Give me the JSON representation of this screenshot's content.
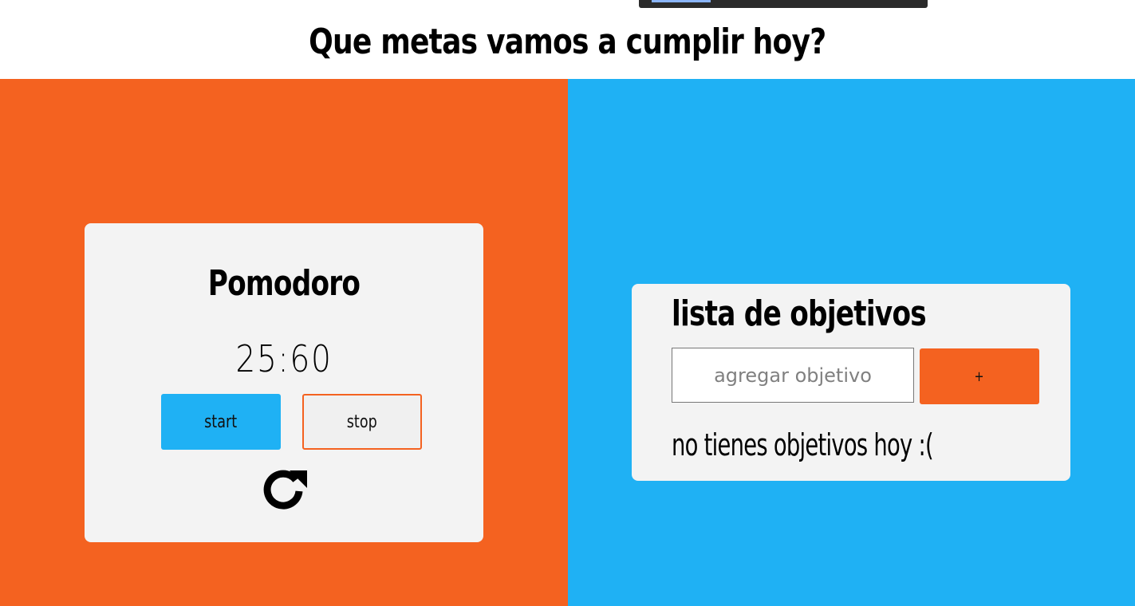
{
  "header": {
    "title": "Que metas vamos a cumplir hoy?"
  },
  "pomodoro": {
    "title": "Pomodoro",
    "time": "25:60",
    "start_label": "start",
    "stop_label": "stop",
    "reset_icon": "reset-icon"
  },
  "goals": {
    "title": "lista de objetivos",
    "input_placeholder": "agregar objetivo",
    "add_label": "+",
    "empty_message": "no tienes objetivos hoy :("
  },
  "colors": {
    "orange": "#f46220",
    "blue": "#1fb1f4",
    "card": "#f3f3f3"
  }
}
